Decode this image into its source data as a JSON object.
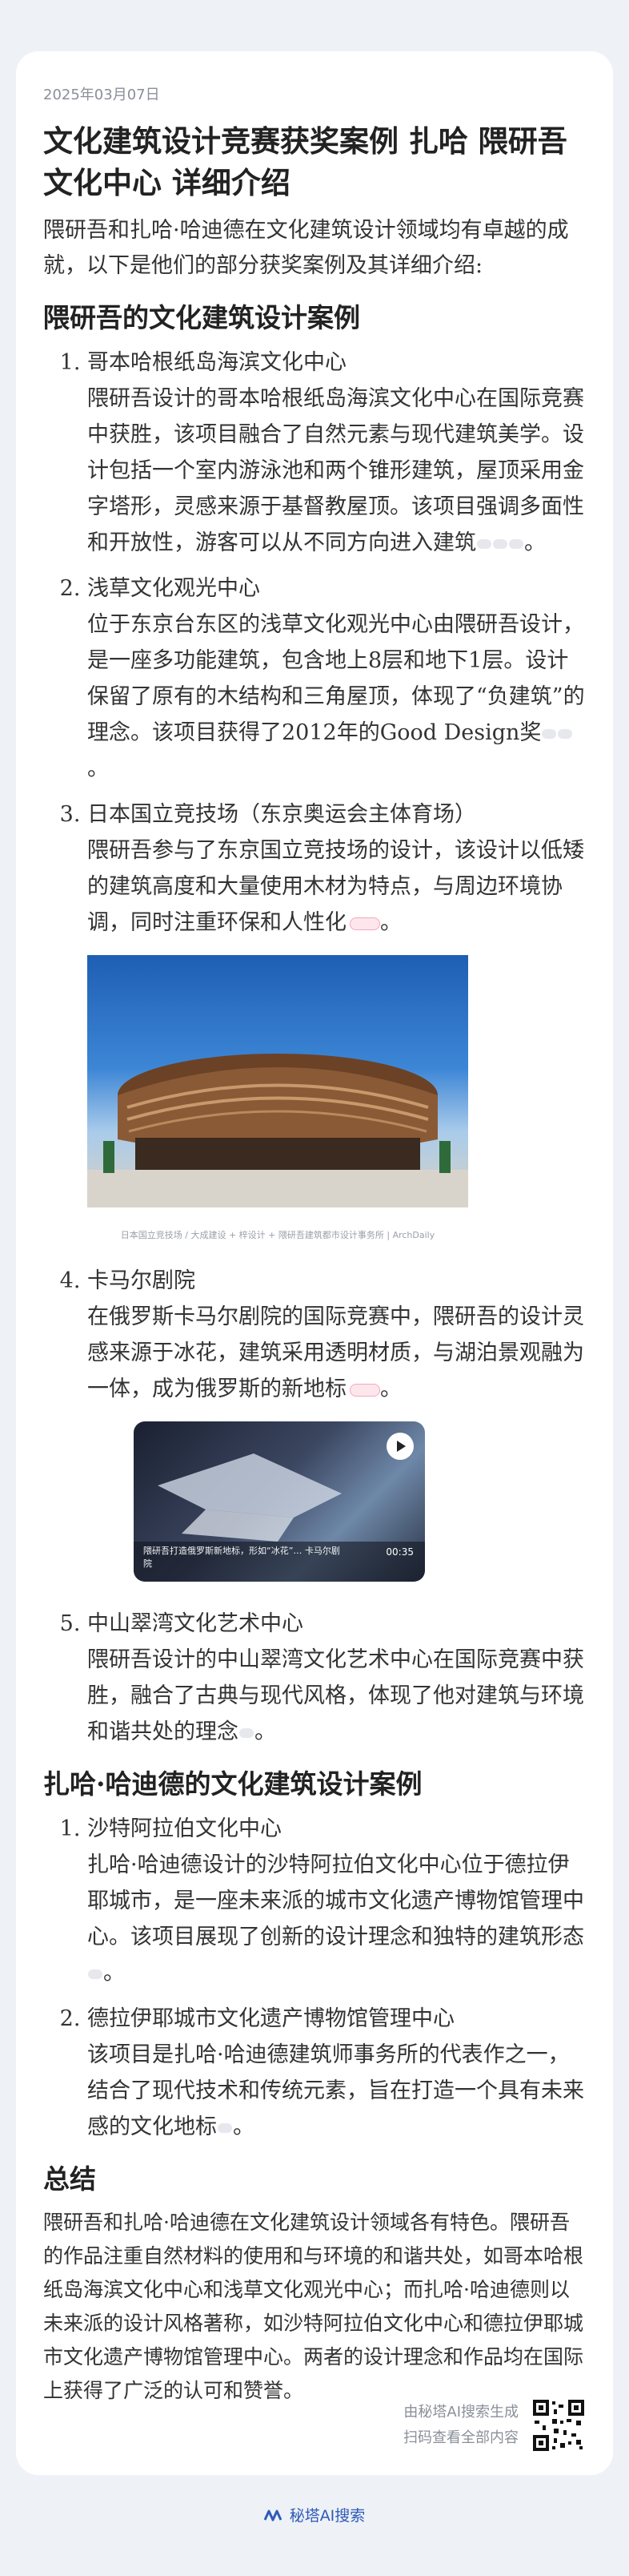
{
  "date": "2025年03月07日",
  "title": "文化建筑设计竞赛获奖案例 扎哈 隈研吾 文化中心 详细介绍",
  "intro": "隈研吾和扎哈·哈迪德在文化建筑设计领域均有卓越的成就，以下是他们的部分获奖案例及其详细介绍:",
  "kuma": {
    "heading": "隈研吾的文化建筑设计案例",
    "items": [
      {
        "title": "哥本哈根纸岛海滨文化中心",
        "body": "隈研吾设计的哥本哈根纸岛海滨文化中心在国际竞赛中获胜，该项目融合了自然元素与现代建筑美学。设计包括一个室内游泳池和两个锥形建筑，屋顶采用金字塔形，灵感来源于基督教屋顶。该项目强调多面性和开放性，游客可以从不同方向进入建筑"
      },
      {
        "title": "浅草文化观光中心",
        "body": "位于东京台东区的浅草文化观光中心由隈研吾设计，是一座多功能建筑，包含地上8层和地下1层。设计保留了原有的木结构和三角屋顶，体现了“负建筑”的理念。该项目获得了2012年的Good Design奖"
      },
      {
        "title": "日本国立竞技场（东京奥运会主体育场）",
        "body": "隈研吾参与了东京国立竞技场的设计，该设计以低矮的建筑高度和大量使用木材为特点，与周边环境协调，同时注重环保和人性化"
      },
      {
        "title": "卡马尔剧院",
        "body": "在俄罗斯卡马尔剧院的国际竞赛中，隈研吾的设计灵感来源于冰花，建筑采用透明材质，与湖泊景观融为一体，成为俄罗斯的新地标"
      },
      {
        "title": "中山翠湾文化艺术中心",
        "body": "隈研吾设计的中山翠湾文化艺术中心在国际竞赛中获胜，融合了古典与现代风格，体现了他对建筑与环境和谐共处的理念"
      }
    ],
    "image_caption": "日本国立竞技场 / 大成建设 + 梓设计 + 隈研吾建筑都市设计事务所 | ArchDaily",
    "video_caption": "隈研吾打造俄罗斯新地标，形如“冰花”… 卡马尔剧院",
    "video_time": "00:35"
  },
  "zaha": {
    "heading": "扎哈·哈迪德的文化建筑设计案例",
    "items": [
      {
        "title": "沙特阿拉伯文化中心",
        "body": "扎哈·哈迪德设计的沙特阿拉伯文化中心位于德拉伊耶城市，是一座未来派的城市文化遗产博物馆管理中心。该项目展现了创新的设计理念和独特的建筑形态"
      },
      {
        "title": "德拉伊耶城市文化遗产博物馆管理中心",
        "body": "该项目是扎哈·哈迪德建筑师事务所的代表作之一，结合了现代技术和传统元素，旨在打造一个具有未来感的文化地标"
      }
    ]
  },
  "summary": {
    "heading": "总结",
    "text": "隈研吾和扎哈·哈迪德在文化建筑设计领域各有特色。隈研吾的作品注重自然材料的使用和与环境的和谐共处，如哥本哈根纸岛海滨文化中心和浅草文化观光中心；而扎哈·哈迪德则以未来派的设计风格著称，如沙特阿拉伯文化中心和德拉伊耶城市文化遗产博物馆管理中心。两者的设计理念和作品均在国际上获得了广泛的认可和赞誉。"
  },
  "footer": {
    "generated": "由秘塔AI搜索生成",
    "scan": "扫码查看全部内容",
    "brand": "秘塔AI搜索"
  },
  "colors": {
    "accent": "#2e5bb8",
    "page_bg": "#eef1f6"
  }
}
